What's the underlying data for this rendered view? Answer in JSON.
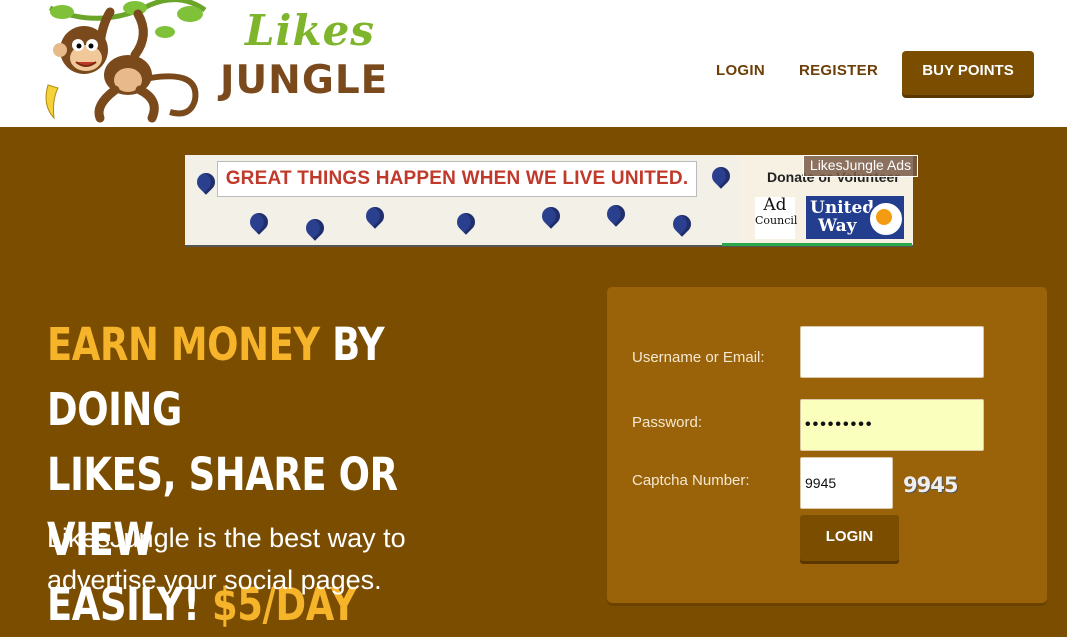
{
  "brand": {
    "name_line1": "Likes",
    "name_line2": "JUNGLE"
  },
  "nav": {
    "login": "LOGIN",
    "register": "REGISTER",
    "buy_points": "BUY POINTS"
  },
  "ad": {
    "headline": "GREAT THINGS HAPPEN WHEN WE LIVE UNITED.",
    "donate": "Donate or Volunteer",
    "ad_council_line1": "Ad",
    "ad_council_line2": "Council",
    "united_way_line1": "United",
    "united_way_line2": "Way",
    "tag": "LikesJungle Ads"
  },
  "hero": {
    "title_highlight": "EARN MONEY",
    "title_rest_1": " BY DOING",
    "title_line2": "LIKES, SHARE OR VIEW",
    "title_line3": "EASILY! ",
    "title_price": "$5/DAY",
    "subtitle": "LikesJungle is the best way to advertise your social pages."
  },
  "login_form": {
    "username_label": "Username or Email:",
    "username_value": "",
    "password_label": "Password:",
    "password_value": "•••••••••",
    "captcha_label": "Captcha Number:",
    "captcha_value": "9945",
    "captcha_image_text": "9945",
    "submit": "LOGIN"
  },
  "colors": {
    "brown_bg": "#7a4d00",
    "panel": "#9a6309",
    "accent_yellow": "#f6b42b",
    "logo_green": "#7fb52c",
    "logo_brown": "#7a4a1d"
  }
}
